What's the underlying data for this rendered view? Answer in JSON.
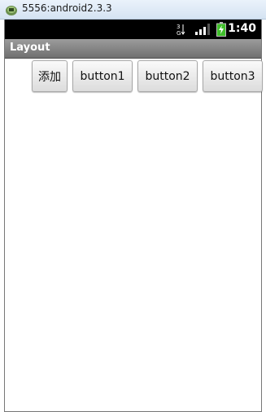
{
  "window": {
    "title": "5556:android2.3.3"
  },
  "status_bar": {
    "time": "1:40",
    "network_icon": "3g-icon",
    "signal_icon": "signal-bars-icon",
    "battery_icon": "battery-charging-icon"
  },
  "app": {
    "title": "Layout"
  },
  "buttons": [
    {
      "label": "添加"
    },
    {
      "label": "button1"
    },
    {
      "label": "button2"
    },
    {
      "label": "button3"
    }
  ],
  "colors": {
    "status_bar_bg": "#000000",
    "app_title_bg": "#8a8a8a",
    "battery_green": "#3fbf2a"
  }
}
